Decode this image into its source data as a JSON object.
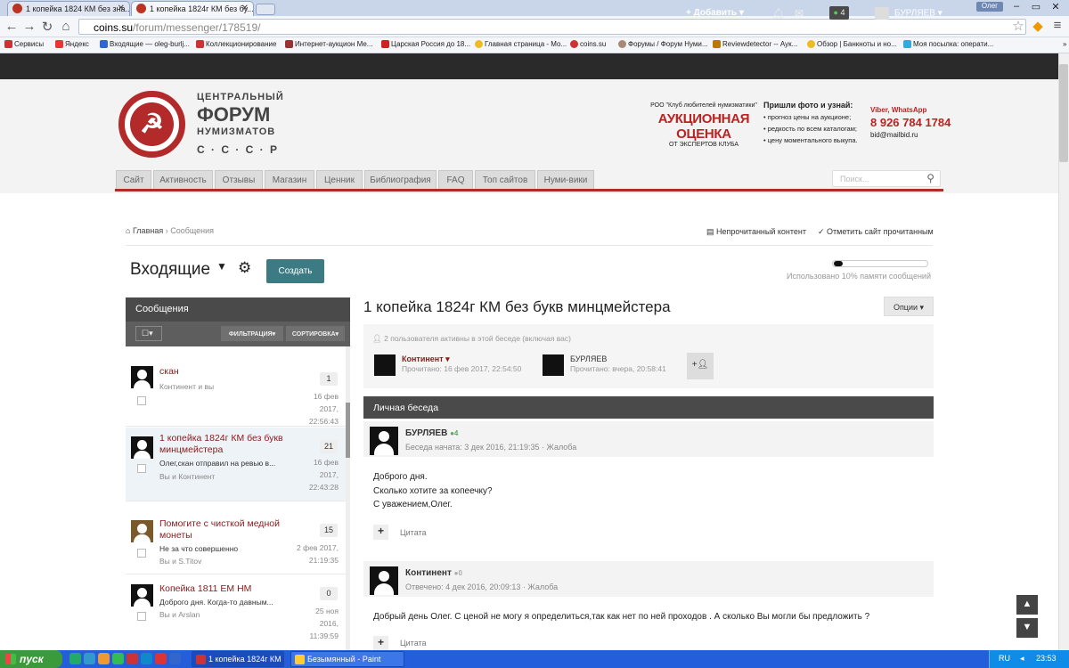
{
  "browser": {
    "tabs": [
      {
        "label": "1 копейка 1824 КМ без зна..."
      },
      {
        "label": "1 копейка 1824г КМ без бу..."
      }
    ],
    "window_user": "Олег",
    "url_host": "coins.su",
    "url_path": "/forum/messenger/178519/",
    "bookmarks": [
      {
        "label": "Сервисы"
      },
      {
        "label": "Яндекс"
      },
      {
        "label": "Входящие — oleg-burlj..."
      },
      {
        "label": "Коллекционирование"
      },
      {
        "label": "Интернет-аукцион Ме..."
      },
      {
        "label": "Царская Россия до 18..."
      },
      {
        "label": "Главная страница - Мо..."
      },
      {
        "label": "coins.su"
      },
      {
        "label": "Форумы / Форум Нуми..."
      },
      {
        "label": "Reviewdetector -- Аук..."
      },
      {
        "label": "Обзор | Банкноты и но..."
      },
      {
        "label": "Моя посылка: операти..."
      }
    ]
  },
  "topbar": {
    "add_label": "Добавить",
    "notif_count": "4",
    "username": "БУРЛЯЕВ"
  },
  "header": {
    "logo_line1": "ЦЕНТРАЛЬНЫЙ",
    "logo_line2": "ФОРУМ",
    "logo_line3": "НУМИЗМАТОВ",
    "logo_line4": "С · С · С · Р",
    "ad_org": "РОО \"Клуб любителей нумизматики\"",
    "ad_title": "АУКЦИОННАЯ ОЦЕНКА",
    "ad_sub": "ОТ ЭКСПЕРТОВ КЛУБА",
    "ad_heading": "Пришли фото и узнай:",
    "ad_points": [
      "прогноз цены на аукционе;",
      "редкость по всем каталогам;",
      "цену моментального выкупа."
    ],
    "ad_contact_label": "Viber, WhatsApp",
    "ad_phone": "8 926 784 1784",
    "ad_email": "bid@mailbid.ru"
  },
  "nav": {
    "tabs": [
      "Сайт",
      "Активность",
      "Отзывы",
      "Магазин",
      "Ценник",
      "Библиография",
      "FAQ",
      "Топ сайтов",
      "Нуми-вики"
    ],
    "search_placeholder": "Поиск..."
  },
  "breadcrumb": {
    "home": "Главная",
    "current": "Сообщения",
    "unread": "Непрочитанный контент",
    "mark_read": "Отметить сайт прочитанным"
  },
  "inbox": {
    "title": "Входящие",
    "create": "Создать",
    "quota_text": "Использовано 10% памяти сообщений",
    "quota_fraction": 0.1
  },
  "left_panel": {
    "title": "Сообщения",
    "filter": "ФИЛЬТРАЦИЯ",
    "sort": "СОРТИРОВКА",
    "conversations": [
      {
        "title": "скан",
        "preview": "",
        "participants": "Континент и вы",
        "count": "1",
        "date1": "16 фев",
        "date2": "2017,",
        "date3": "22:56:43"
      },
      {
        "title": "1 копейка 1824г КМ без букв минцмейстера",
        "preview": "Олег,скан отправил на ревью в...",
        "participants": "Вы и Континент",
        "count": "21",
        "date1": "16 фев",
        "date2": "2017,",
        "date3": "22:43:28"
      },
      {
        "title": "Помогите с чисткой медной монеты",
        "preview": "Не за что совершенно",
        "participants": "Вы и S.Titov",
        "count": "15",
        "date1": "2 фев 2017,",
        "date2": "21:19:35",
        "date3": ""
      },
      {
        "title": "Копейка 1811 ЕМ НМ",
        "preview": "Доброго дня. Когда-то давным...",
        "participants": "Вы и Arslan",
        "count": "0",
        "date1": "25 ноя",
        "date2": "2016,",
        "date3": "11:39:59"
      }
    ]
  },
  "conversation": {
    "title": "1 копейка 1824г КМ без букв минцмейстера",
    "options": "Опции",
    "active_users": "2 пользователя активны в этой беседе (включая вас)",
    "participants": [
      {
        "name": "Континент",
        "read": "Прочитано: 16 фев 2017, 22:54:50"
      },
      {
        "name": "БУРЛЯЕВ",
        "read": "Прочитано: вчера, 20:58:41"
      }
    ],
    "private_label": "Личная беседа",
    "posts": [
      {
        "author": "БУРЛЯЕВ",
        "rep": "4",
        "meta": "Беседа начата: 3 дек 2016, 21:19:35 · Жалоба",
        "lines": [
          "Доброго дня.",
          "Сколько хотите за копеечку?",
          "С уважением,Олег."
        ],
        "quote": "Цитата"
      },
      {
        "author": "Континент",
        "rep": "0",
        "meta": "Отвечено: 4 дек 2016, 20:09:13 · Жалоба",
        "lines": [
          "Добрый день Олег. С ценой не могу я определиться,так как нет по ней проходов . А сколько Вы могли бы предложить ?"
        ],
        "quote": "Цитата"
      }
    ]
  },
  "taskbar": {
    "start": "пуск",
    "tasks": [
      "1 копейка 1824г КМ ...",
      "Безымянный - Paint"
    ],
    "lang": "RU",
    "time": "23:53"
  }
}
